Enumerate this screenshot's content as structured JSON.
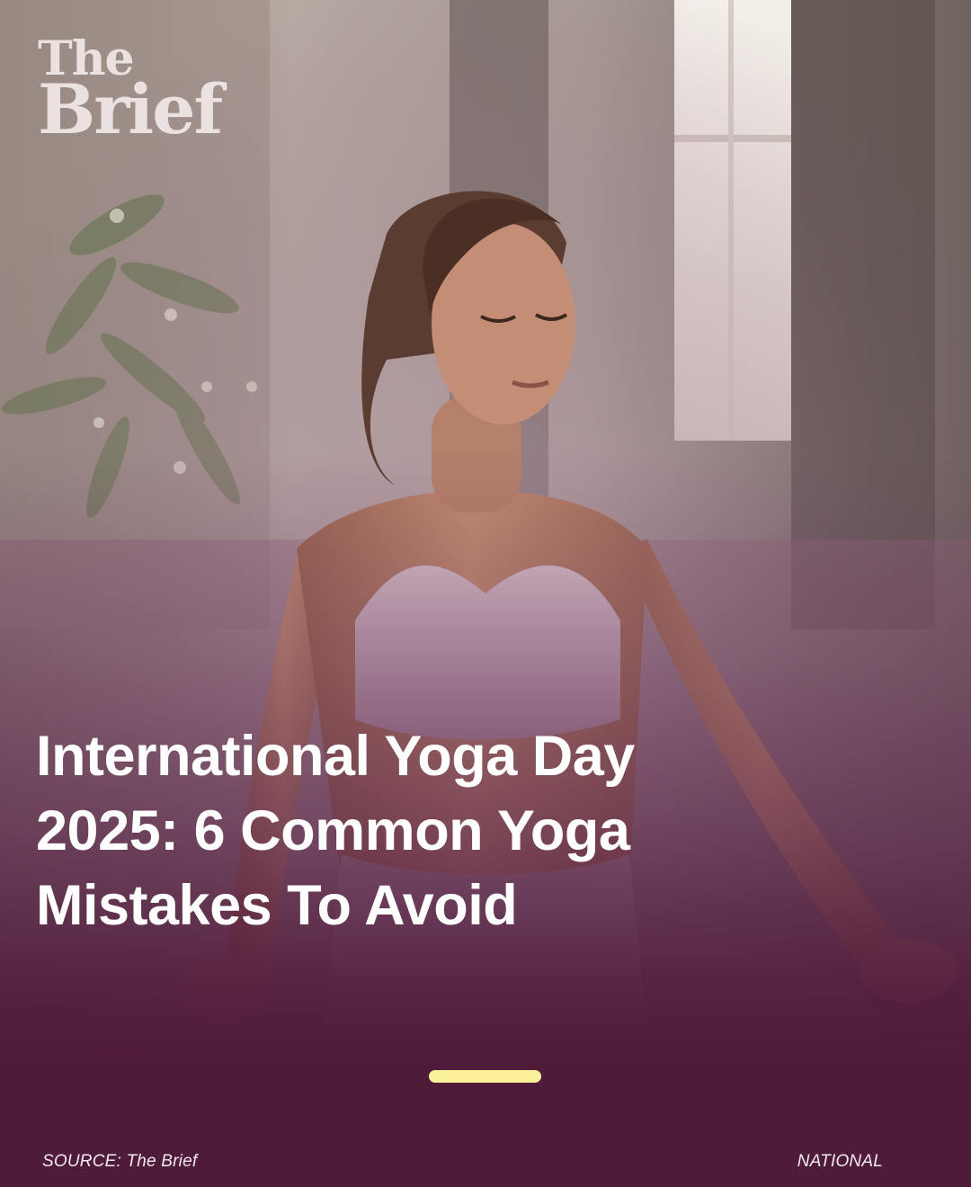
{
  "logo": {
    "line1": "The",
    "line2": "Brief"
  },
  "headline": "International Yoga Day 2025: 6 Common Yoga Mistakes To Avoid",
  "footer": {
    "source": "SOURCE: The Brief",
    "category": "NATIONAL"
  },
  "colors": {
    "overlay": "#4e1b39",
    "pager": "#fbf19a",
    "text": "#ffffff"
  },
  "pager": {
    "active_page": 1
  }
}
